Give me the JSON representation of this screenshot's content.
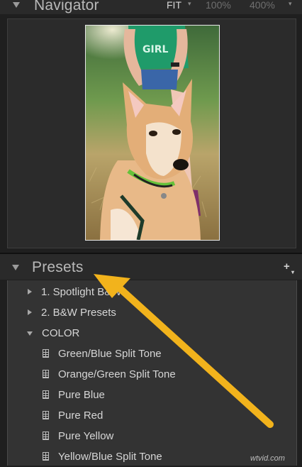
{
  "navigator": {
    "title": "Navigator",
    "zoom_options": [
      "FIT",
      "100%",
      "400%"
    ],
    "active_zoom": "FIT",
    "photo_text": "GIRL"
  },
  "presets": {
    "title": "Presets",
    "add_icon": "plus-icon",
    "items": [
      {
        "label": "1. Spotlight B&W",
        "type": "folder",
        "expanded": false
      },
      {
        "label": "2. B&W Presets",
        "type": "folder",
        "expanded": false
      },
      {
        "label": "COLOR",
        "type": "folder",
        "expanded": true
      },
      {
        "label": "Green/Blue Split Tone",
        "type": "preset"
      },
      {
        "label": "Orange/Green Split Tone",
        "type": "preset"
      },
      {
        "label": "Pure Blue",
        "type": "preset"
      },
      {
        "label": "Pure Red",
        "type": "preset"
      },
      {
        "label": "Pure Yellow",
        "type": "preset"
      },
      {
        "label": "Yellow/Blue Split Tone",
        "type": "preset"
      }
    ]
  },
  "annotation": {
    "arrow_color": "#f2b31c"
  },
  "watermark": "wtvid.com"
}
